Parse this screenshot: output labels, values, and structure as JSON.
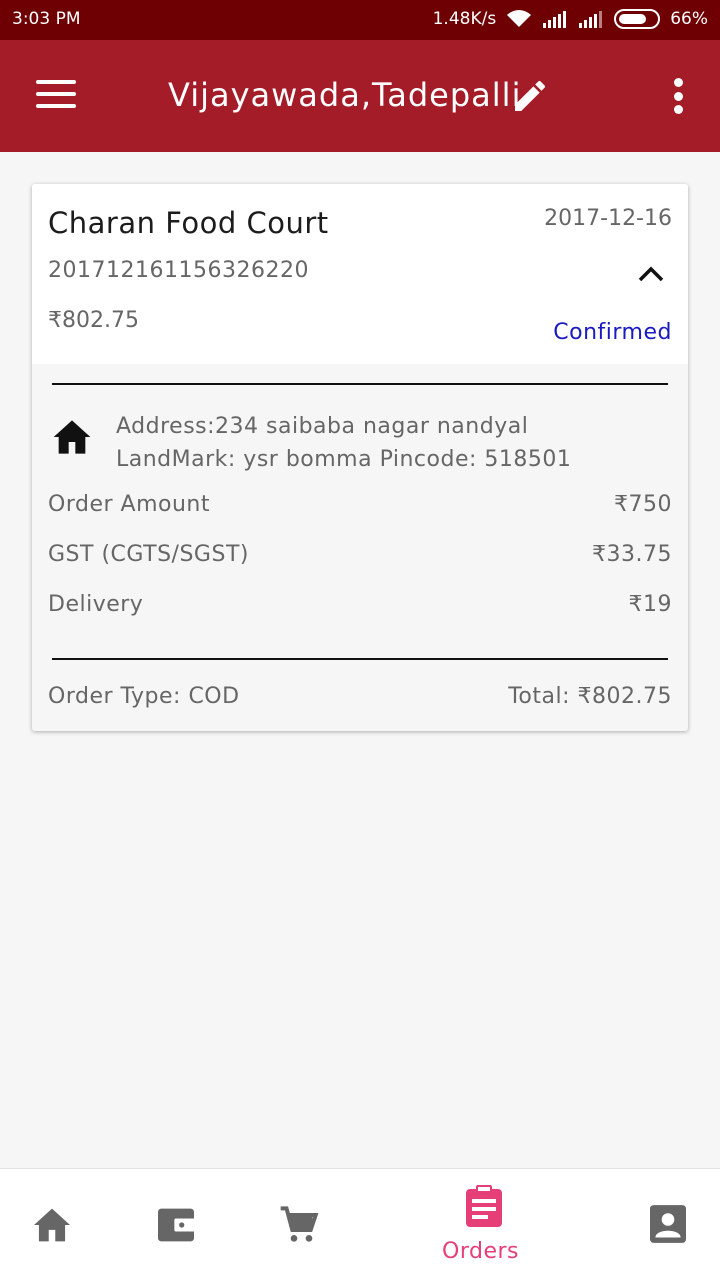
{
  "status_bar": {
    "time": "3:03 PM",
    "speed": "1.48K/s",
    "battery": "66%"
  },
  "app_bar": {
    "title": "Vijayawada,Tadepalli",
    "icons": [
      "menu-icon",
      "edit-pencil-icon",
      "more-vert-icon"
    ]
  },
  "order": {
    "store": "Charan Food Court",
    "date": "2017-12-16",
    "order_id": "201712161156326220",
    "amount": "₹802.75",
    "status": "Confirmed",
    "address_line1": "Address:234 saibaba nagar nandyal",
    "address_line2": "LandMark: ysr bomma Pincode: 518501",
    "order_amount_label": "Order Amount",
    "order_amount_value": "₹750",
    "gst_label": "GST (CGTS/SGST)",
    "gst_value": "₹33.75",
    "delivery_label": "Delivery",
    "delivery_value": "₹19",
    "order_type": "Order Type: COD",
    "total": "Total: ₹802.75"
  },
  "bottom_nav": {
    "items": [
      "home-icon",
      "wallet-icon",
      "cart-icon",
      "orders-icon",
      "account-icon"
    ],
    "active_label": "Orders",
    "active_color": "#e63f78"
  },
  "colors": {
    "status_bar": "#6e0003",
    "app_bar": "#a51c29",
    "status_text": "#1a1ac0"
  }
}
